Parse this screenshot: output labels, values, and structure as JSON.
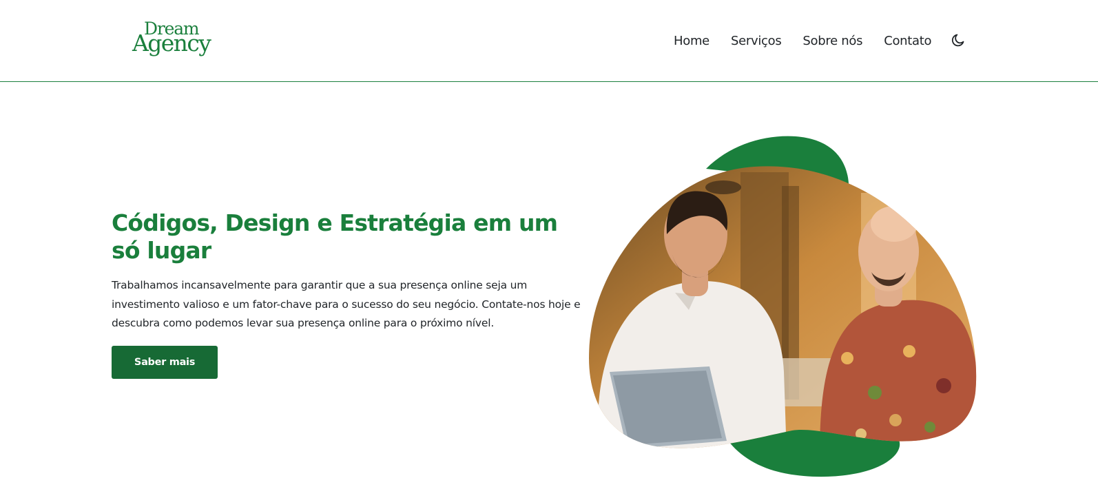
{
  "logo": {
    "line1": "Dream",
    "line2": "Agency"
  },
  "nav": {
    "items": [
      {
        "label": "Home"
      },
      {
        "label": "Serviços"
      },
      {
        "label": "Sobre nós"
      },
      {
        "label": "Contato"
      }
    ],
    "theme_toggle_icon": "moon-icon"
  },
  "hero": {
    "title": "Códigos, Design e Estratégia em um só lugar",
    "text": "Trabalhamos incansavelmente para garantir que a sua presença online seja um investimento valioso e um fator-chave para o sucesso do seu negócio. Contate-nos hoje e descubra como podemos levar sua presença online para o próximo nível.",
    "button_label": "Saber mais",
    "image_subject": "photo-two-men-laptop"
  },
  "colors": {
    "brand_green": "#1a7f3c",
    "button_green": "#176a35",
    "text": "#212529"
  }
}
